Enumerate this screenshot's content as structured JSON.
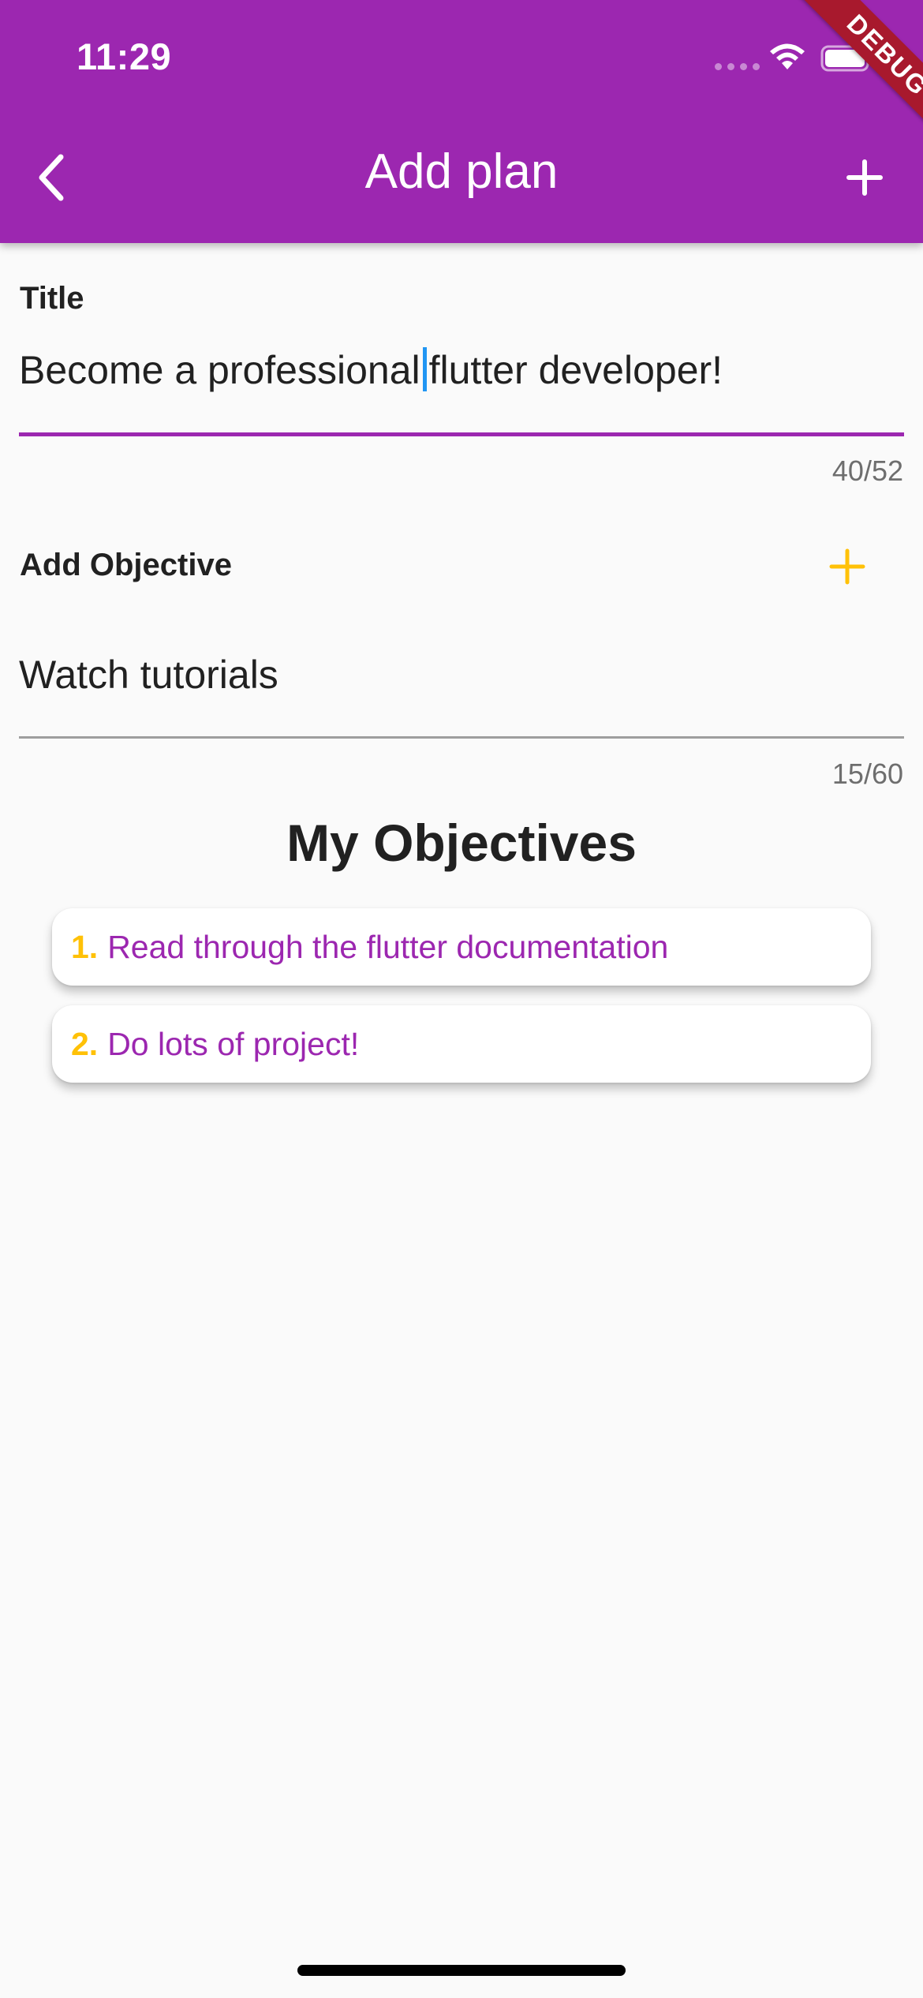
{
  "status_bar": {
    "time": "11:29"
  },
  "debug_banner": "DEBUG",
  "app_bar": {
    "title": "Add plan",
    "back_icon": "chevron-left-icon",
    "action_icon": "plus-icon"
  },
  "title_field": {
    "label": "Title",
    "value_before_cursor": "Become a professional",
    "value_after_cursor": "flutter developer!",
    "counter": "40/52"
  },
  "objective_field": {
    "label": "Add Objective",
    "add_icon": "plus-icon",
    "value": "Watch tutorials",
    "counter": "15/60"
  },
  "objectives_section": {
    "title": "My Objectives",
    "items": [
      {
        "number": "1.",
        "text": "Read through the flutter documentation"
      },
      {
        "number": "2.",
        "text": "Do lots of project!"
      }
    ]
  },
  "colors": {
    "primary": "#9c27b0",
    "accent": "#ffc107",
    "cursor": "#2196f3",
    "background": "#fafafa"
  }
}
